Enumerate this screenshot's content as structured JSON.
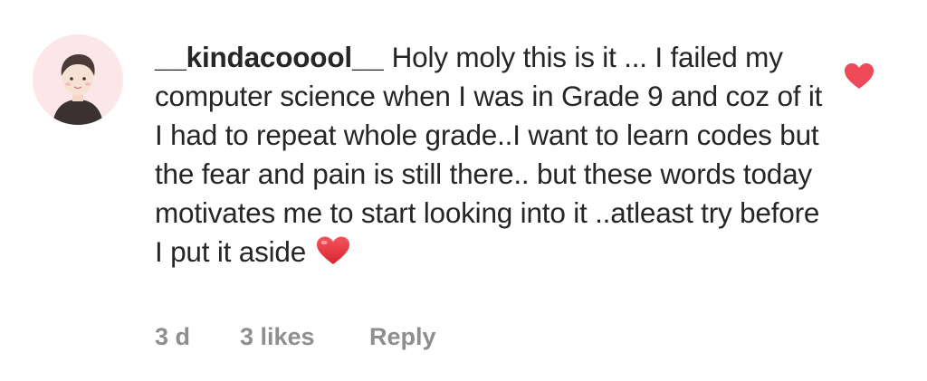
{
  "comment": {
    "username": "__kindacooool__",
    "text": "Holy moly this is it ... I failed my computer science when I was in Grade 9 and coz of it I had to repeat whole grade..I want to learn codes but the fear and pain is still there.. but these words today motivates me to start looking into it ..atleast try before I put it aside",
    "emoji": "red-heart-emoji",
    "timestamp": "3 d",
    "likes": "3 likes",
    "reply_label": "Reply",
    "liked": true
  },
  "icons": {
    "avatar": "cartoon-person-avatar",
    "like": "heart-icon"
  },
  "colors": {
    "text": "#262626",
    "secondary": "#8e8e8e",
    "like_red": "#ed4956",
    "avatar_bg": "#fbe7ea"
  }
}
